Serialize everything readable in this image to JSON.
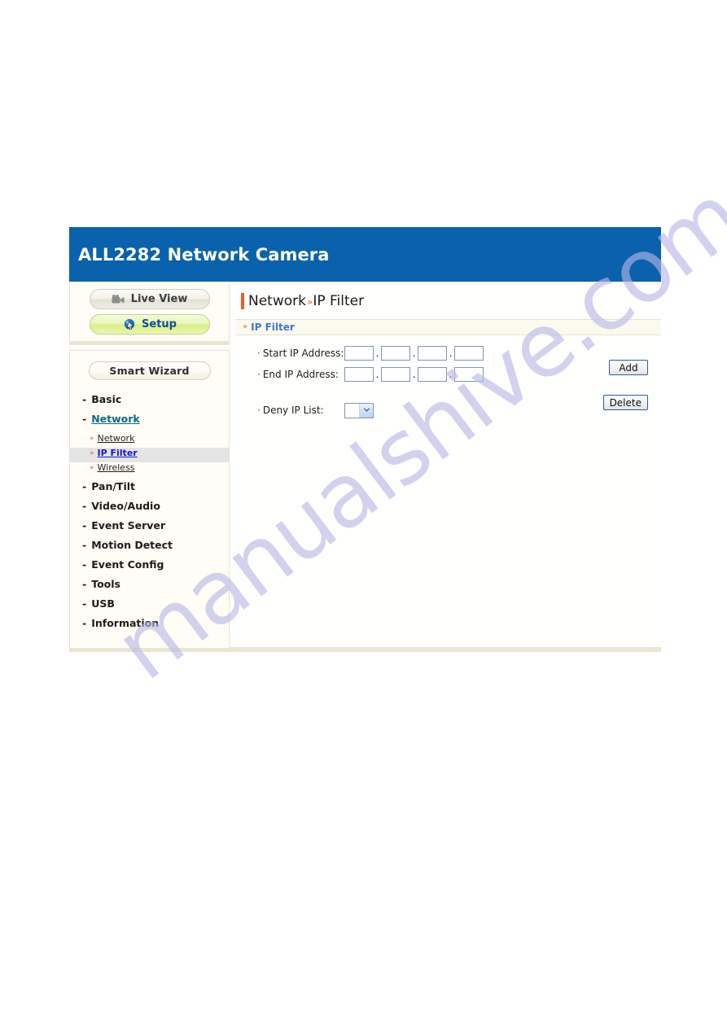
{
  "header": {
    "brand": "ALL2282 Network Camera",
    "brand_color": "#0a62ad"
  },
  "sidebar": {
    "mode_buttons": [
      {
        "label": "Live View",
        "icon": "video-camera-icon",
        "active": false
      },
      {
        "label": "Setup",
        "icon": "cursor-arrow-icon",
        "active": true
      }
    ],
    "wizard_button": {
      "label": "Smart Wizard"
    },
    "nav": [
      {
        "label": "Basic",
        "active": false
      },
      {
        "label": "Network",
        "active": true,
        "children": [
          {
            "label": "Network",
            "selected": false
          },
          {
            "label": "IP Filter",
            "selected": true
          },
          {
            "label": "Wireless",
            "selected": false
          }
        ]
      },
      {
        "label": "Pan/Tilt",
        "active": false
      },
      {
        "label": "Video/Audio",
        "active": false
      },
      {
        "label": "Event Server",
        "active": false
      },
      {
        "label": "Motion Detect",
        "active": false
      },
      {
        "label": "Event Config",
        "active": false
      },
      {
        "label": "Tools",
        "active": false
      },
      {
        "label": "USB",
        "active": false
      },
      {
        "label": "Information",
        "active": false
      }
    ],
    "bullet": "-",
    "sub_bullet": "»"
  },
  "content": {
    "title_primary": "Network",
    "title_separator": "»",
    "title_secondary": "IP Filter",
    "section": {
      "bullet": "»",
      "label": "IP Filter"
    },
    "fields": {
      "start_ip": {
        "bullet": "·",
        "label": "Start IP Address:",
        "octets": [
          "",
          "",
          "",
          ""
        ],
        "separator": "."
      },
      "end_ip": {
        "bullet": "·",
        "label": "End IP Address:",
        "octets": [
          "",
          "",
          "",
          ""
        ],
        "separator": "."
      },
      "deny_list": {
        "bullet": "·",
        "label": "Deny IP List:",
        "selected": "",
        "options": []
      }
    },
    "buttons": {
      "add": "Add",
      "delete": "Delete"
    }
  },
  "watermark": {
    "text": "manualshive.com",
    "color": "#b7b7e8"
  }
}
